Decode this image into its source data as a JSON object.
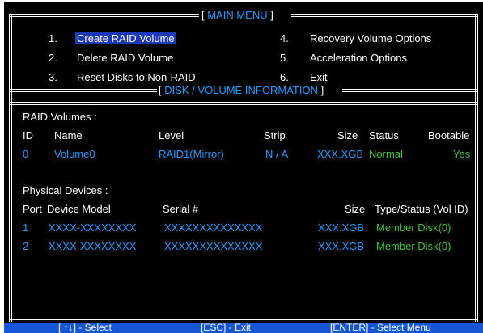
{
  "main_menu": {
    "title": "MAIN MENU",
    "items": [
      {
        "num": "1.",
        "label": "Create RAID Volume"
      },
      {
        "num": "2.",
        "label": "Delete RAID Volume"
      },
      {
        "num": "3.",
        "label": "Reset Disks to Non-RAID"
      },
      {
        "num": "4.",
        "label": "Recovery Volume Options"
      },
      {
        "num": "5.",
        "label": "Acceleration Options"
      },
      {
        "num": "6.",
        "label": "Exit"
      }
    ]
  },
  "info": {
    "title": "DISK / VOLUME INFORMATION",
    "raid_volumes_label": "RAID Volumes :",
    "volume_headers": {
      "id": "ID",
      "name": "Name",
      "level": "Level",
      "strip": "Strip",
      "size": "Size",
      "status": "Status",
      "bootable": "Bootable"
    },
    "volumes": [
      {
        "id": "0",
        "name": "Volume0",
        "level": "RAID1(Mirror)",
        "strip": "N / A",
        "size": "XXX.XGB",
        "status": "Normal",
        "bootable": "Yes"
      }
    ],
    "physical_label": "Physical Devices :",
    "device_headers": {
      "port": "Port",
      "model": "Device Model",
      "serial": "Serial #",
      "size": "Size",
      "type": "Type/Status (Vol ID)"
    },
    "devices": [
      {
        "port": "1",
        "model": "XXXX-XXXXXXXX",
        "serial": "XXXXXXXXXXXXXX",
        "size": "XXX.XGB",
        "type": "Member Disk(0)"
      },
      {
        "port": "2",
        "model": "XXXX-XXXXXXXX",
        "serial": "XXXXXXXXXXXXXX",
        "size": "XXX.XGB",
        "type": "Member Disk(0)"
      }
    ]
  },
  "footer": {
    "select": "[ ↑↓] - Select",
    "exit": "[ESC] - Exit",
    "enter": "[ENTER] - Select Menu"
  },
  "colors": {
    "background": "#000000",
    "accent": "#1e9cff",
    "ok": "#3cc43c",
    "highlight": "#1c38b8",
    "footer": "#1656d6"
  }
}
